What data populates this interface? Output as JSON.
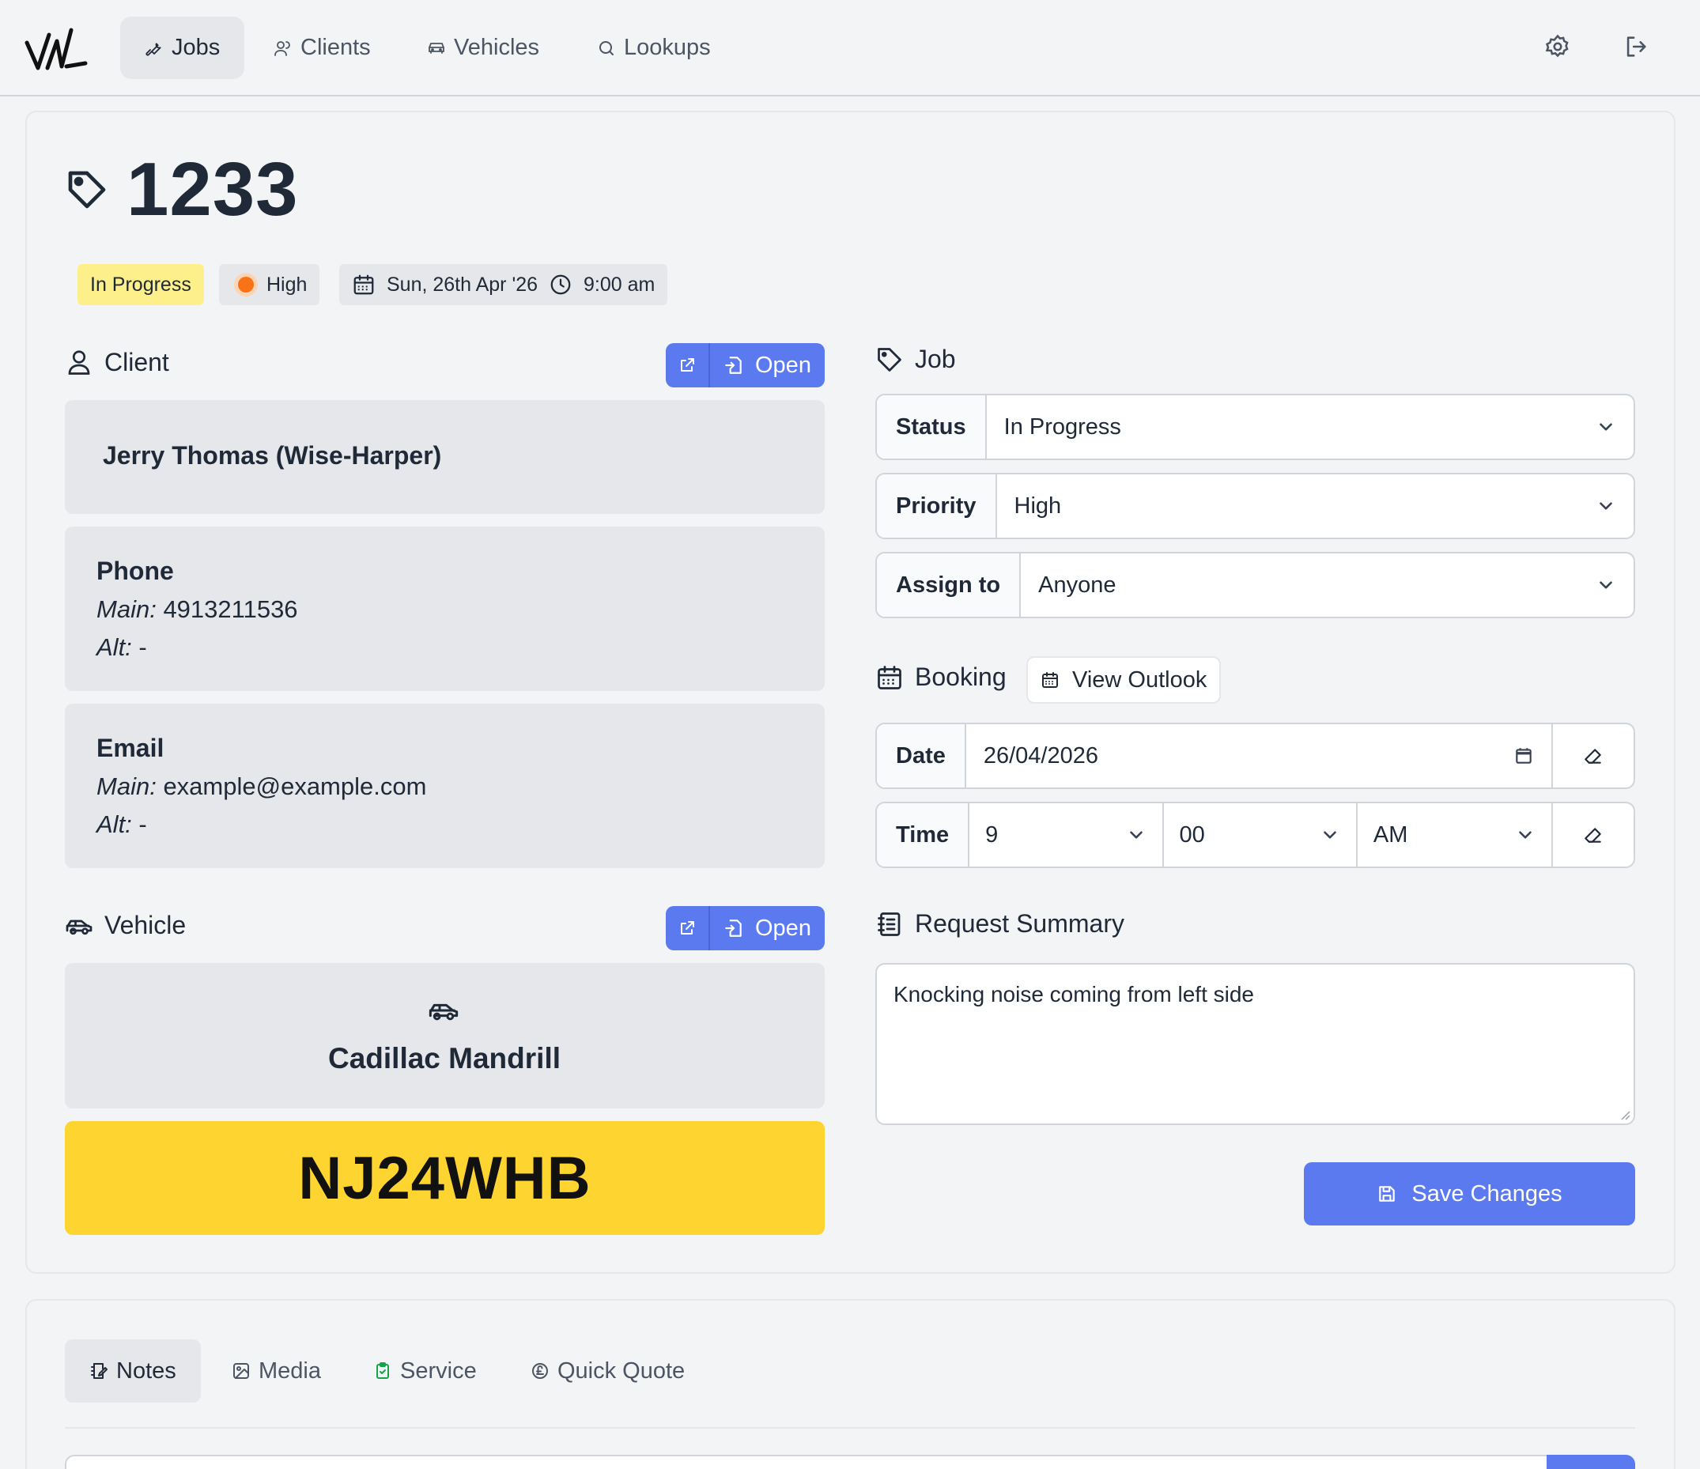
{
  "nav": {
    "items": [
      {
        "label": "Jobs",
        "icon": "wrench-icon"
      },
      {
        "label": "Clients",
        "icon": "users-icon"
      },
      {
        "label": "Vehicles",
        "icon": "car-icon"
      },
      {
        "label": "Lookups",
        "icon": "search-icon"
      }
    ],
    "right_icons": [
      "gear-icon",
      "logout-icon"
    ]
  },
  "job": {
    "number": "1233",
    "status_badge": "In Progress",
    "priority_badge": "High",
    "date_badge": "Sun, 26th Apr '26",
    "time_badge": "9:00 am"
  },
  "client": {
    "heading": "Client",
    "open_label": "Open",
    "name": "Jerry Thomas (Wise-Harper)",
    "phone_title": "Phone",
    "phone_main_label": "Main:",
    "phone_main": "4913211536",
    "phone_alt_label": "Alt:",
    "phone_alt": "-",
    "email_title": "Email",
    "email_main_label": "Main:",
    "email_main": "example@example.com",
    "email_alt_label": "Alt:",
    "email_alt": "-"
  },
  "vehicle": {
    "heading": "Vehicle",
    "open_label": "Open",
    "name": "Cadillac Mandrill",
    "plate": "NJ24WHB"
  },
  "job_form": {
    "heading": "Job",
    "status_label": "Status",
    "status_value": "In Progress",
    "priority_label": "Priority",
    "priority_value": "High",
    "assign_label": "Assign to",
    "assign_value": "Anyone"
  },
  "booking": {
    "heading": "Booking",
    "outlook_label": "View Outlook",
    "date_label": "Date",
    "date_value": "26/04/2026",
    "time_label": "Time",
    "hour_value": "9",
    "minute_value": "00",
    "ampm_value": "AM"
  },
  "summary": {
    "heading": "Request Summary",
    "text": "Knocking noise coming from left side"
  },
  "save_label": "Save Changes",
  "tabs": [
    {
      "label": "Notes",
      "icon": "notes-icon"
    },
    {
      "label": "Media",
      "icon": "image-icon"
    },
    {
      "label": "Service",
      "icon": "clipboard-icon"
    },
    {
      "label": "Quick Quote",
      "icon": "pound-icon"
    }
  ],
  "colors": {
    "accent": "#5b7af0",
    "status_yellow": "#fdf08a",
    "priority_orange": "#f97316",
    "plate_yellow": "#fdd430",
    "service_green": "#16a34a"
  }
}
